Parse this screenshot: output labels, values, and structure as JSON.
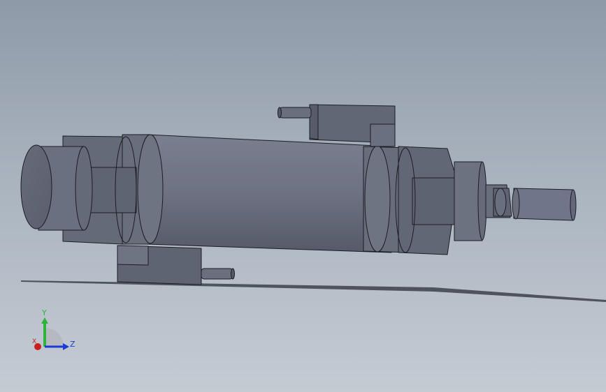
{
  "viewport": {
    "background_top": "#8e9aa8",
    "background_bottom": "#c4cbd3"
  },
  "model": {
    "body_color": "#6a6f7e",
    "edge_color": "#1b1d24"
  },
  "triad": {
    "y_label": "Y",
    "z_label": "Z",
    "x_label": "X",
    "y_color": "#2fb33a",
    "z_color": "#1b3bd6",
    "x_color": "#c81e1e"
  }
}
